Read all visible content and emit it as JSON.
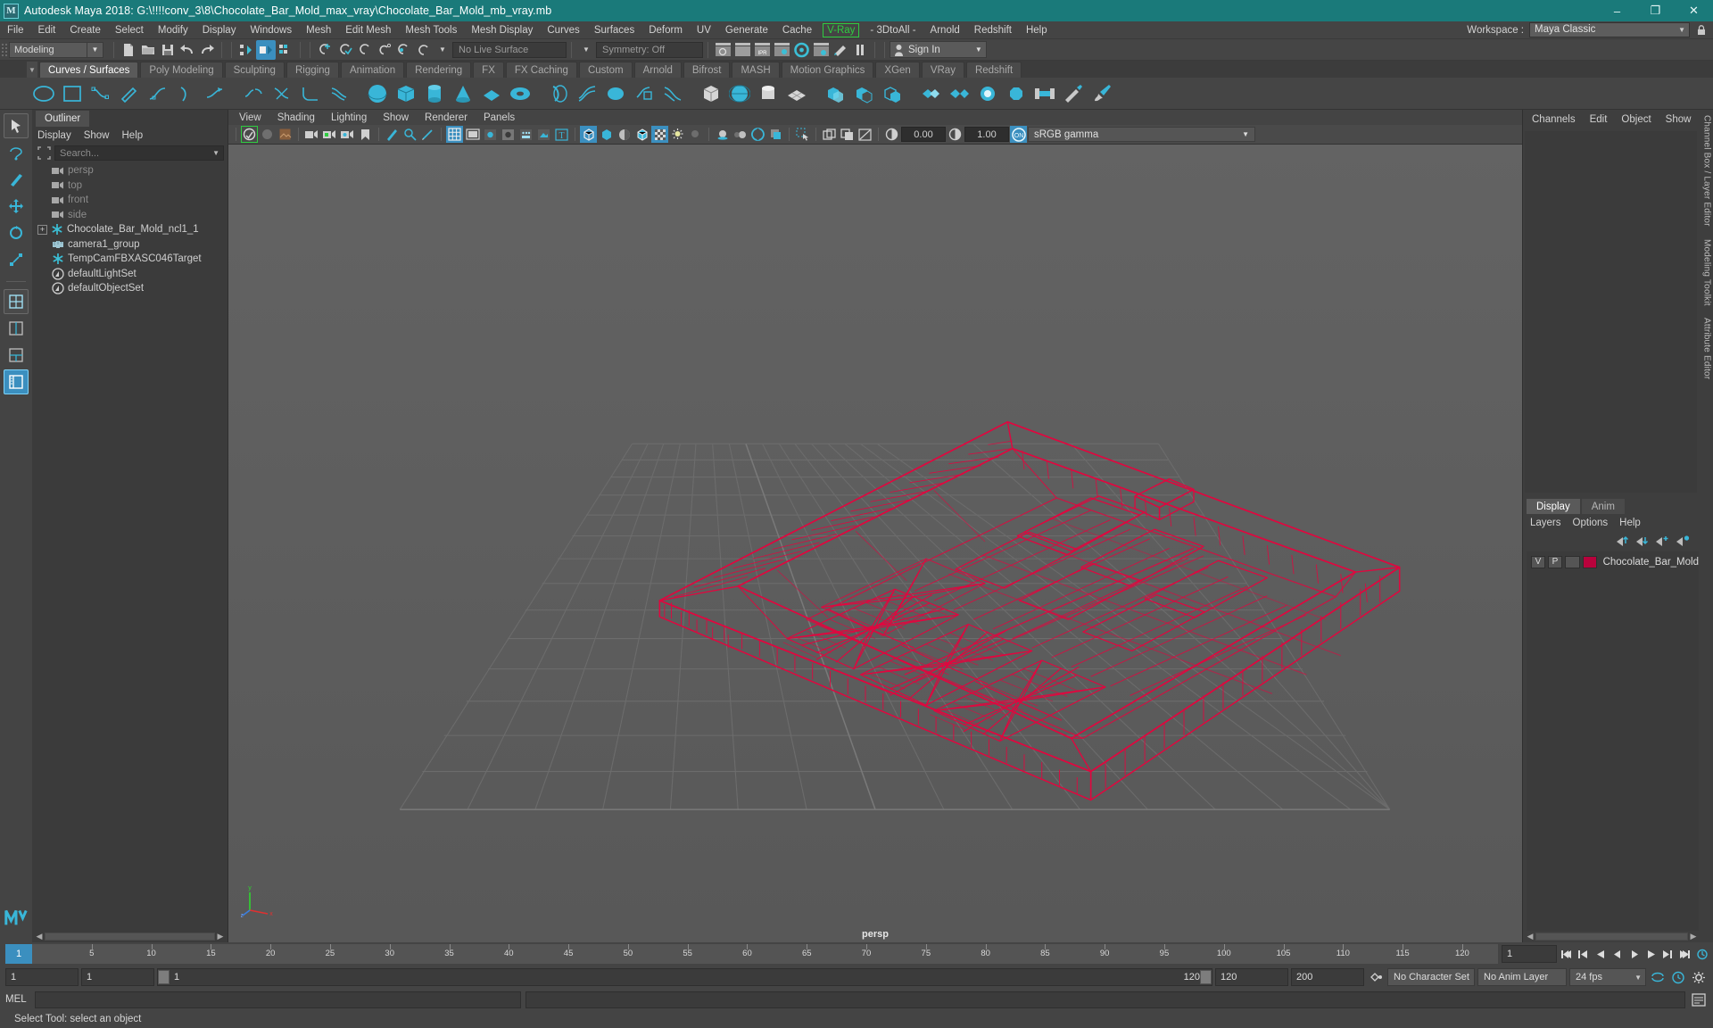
{
  "window": {
    "title": "Autodesk Maya 2018: G:\\!!!!conv_3\\8\\Chocolate_Bar_Mold_max_vray\\Chocolate_Bar_Mold_mb_vray.mb",
    "logo_text": "M",
    "minimize": "–",
    "maximize": "❐",
    "close": "✕"
  },
  "menubar": {
    "items": [
      "File",
      "Edit",
      "Create",
      "Select",
      "Modify",
      "Display",
      "Windows",
      "Mesh",
      "Edit Mesh",
      "Mesh Tools",
      "Mesh Display",
      "Curves",
      "Surfaces",
      "Deform",
      "UV",
      "Generate",
      "Cache"
    ],
    "vray": "V-Ray",
    "items_after": [
      "- 3DtoAll -",
      "Arnold",
      "Redshift",
      "Help"
    ],
    "workspace_label": "Workspace :",
    "workspace_value": "Maya Classic"
  },
  "toolbar": {
    "mode": "Modeling",
    "live_surface": "No Live Surface",
    "symmetry": "Symmetry: Off",
    "signin": "Sign In"
  },
  "shelf": {
    "tabs": [
      "Curves / Surfaces",
      "Poly Modeling",
      "Sculpting",
      "Rigging",
      "Animation",
      "Rendering",
      "FX",
      "FX Caching",
      "Custom",
      "Arnold",
      "Bifrost",
      "MASH",
      "Motion Graphics",
      "XGen",
      "VRay",
      "Redshift"
    ],
    "active_tab": "Curves / Surfaces"
  },
  "outliner": {
    "tab_label": "Outliner",
    "menu": [
      "Display",
      "Show",
      "Help"
    ],
    "search_placeholder": "Search...",
    "items": [
      {
        "label": "persp",
        "icon": "camera-icon",
        "dim": true,
        "expandable": false,
        "indent": 22
      },
      {
        "label": "top",
        "icon": "camera-icon",
        "dim": true,
        "expandable": false,
        "indent": 22
      },
      {
        "label": "front",
        "icon": "camera-icon",
        "dim": true,
        "expandable": false,
        "indent": 22
      },
      {
        "label": "side",
        "icon": "camera-icon",
        "dim": true,
        "expandable": false,
        "indent": 22
      },
      {
        "label": "Chocolate_Bar_Mold_ncl1_1",
        "icon": "asterisk-icon",
        "dim": false,
        "expandable": true,
        "indent": 6
      },
      {
        "label": "camera1_group",
        "icon": "group-icon",
        "dim": false,
        "expandable": false,
        "indent": 22
      },
      {
        "label": "TempCamFBXASC046Target",
        "icon": "asterisk-icon",
        "dim": false,
        "expandable": false,
        "indent": 22
      },
      {
        "label": "defaultLightSet",
        "icon": "set-icon",
        "dim": false,
        "expandable": false,
        "indent": 22
      },
      {
        "label": "defaultObjectSet",
        "icon": "set-icon",
        "dim": false,
        "expandable": false,
        "indent": 22
      }
    ]
  },
  "viewport": {
    "menu": [
      "View",
      "Shading",
      "Lighting",
      "Show",
      "Renderer",
      "Panels"
    ],
    "exposure": "0.00",
    "gamma_value": "1.00",
    "color_management": "sRGB gamma",
    "camera_label": "persp",
    "axis": {
      "x": "x",
      "y": "y",
      "z": "z"
    },
    "wireframe_color": "#e0073f",
    "bg_color": "#5c5c5c",
    "grid_color": "#6b6b6b"
  },
  "right_panel": {
    "channelbox_menu": [
      "Channels",
      "Edit",
      "Object",
      "Show"
    ],
    "layer_tabs": [
      "Display",
      "Anim"
    ],
    "layer_tab_active": "Display",
    "layer_menu": [
      "Layers",
      "Options",
      "Help"
    ],
    "layers": [
      {
        "v": "V",
        "p": "P",
        "blank": "",
        "color": "#b8023c",
        "name": "Chocolate_Bar_Mold"
      }
    ],
    "vertical_tabs": [
      "Channel Box / Layer Editor",
      "Modeling Toolkit",
      "Attribute Editor"
    ]
  },
  "timeslider": {
    "current_frame": "1",
    "ticks": [
      "5",
      "10",
      "15",
      "20",
      "25",
      "30",
      "35",
      "40",
      "45",
      "50",
      "55",
      "60",
      "65",
      "70",
      "75",
      "80",
      "85",
      "90",
      "95",
      "100",
      "105",
      "110",
      "115",
      "120"
    ],
    "end_field": "1"
  },
  "rangebar": {
    "start": "1",
    "anim_start": "1",
    "slider_min_label": "1",
    "slider_max_label": "120",
    "anim_end": "120",
    "end": "200",
    "character_set": "No Character Set",
    "anim_layer": "No Anim Layer",
    "fps": "24 fps"
  },
  "commandline": {
    "label": "MEL",
    "input_value": "",
    "output_value": ""
  },
  "statusbar": {
    "text": "Select Tool: select an object"
  },
  "colors": {
    "title_bg": "#1a7a7a",
    "accent_blue": "#3b8fbf",
    "teal_icon": "#3bbfd6",
    "vray_green": "#2ecc40",
    "panel_bg": "#444444",
    "dark_field": "#3b3b3b"
  }
}
